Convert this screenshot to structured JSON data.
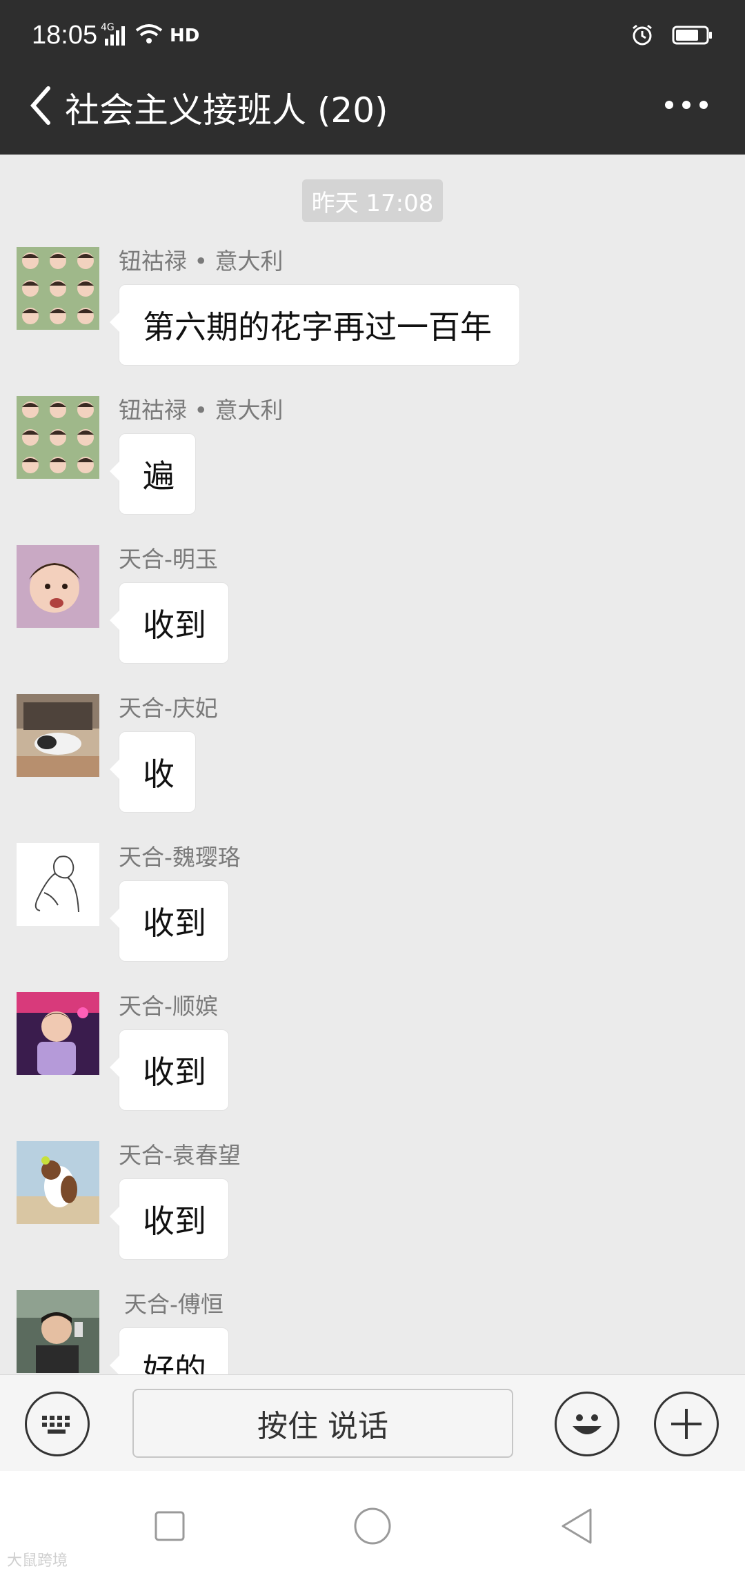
{
  "status_bar": {
    "time": "18:05",
    "network_label": "4G",
    "hd_label": "HD",
    "icons": [
      "signal-icon",
      "wifi-icon",
      "alarm-icon",
      "battery-icon"
    ]
  },
  "header": {
    "title": "社会主义接班人 (20)",
    "back_icon": "chevron-left-icon",
    "more_icon": "more-dots-icon"
  },
  "chat": {
    "timestamp": "昨天 17:08",
    "messages": [
      {
        "sender": "钮祜禄 • 意大利",
        "text": "第六期的花字再过一百年",
        "avatar": "grid-photos-avatar"
      },
      {
        "sender": "钮祜禄 • 意大利",
        "text": "遍",
        "avatar": "grid-photos-avatar"
      },
      {
        "sender": "天合-明玉",
        "text": "收到",
        "avatar": "child-photo-avatar"
      },
      {
        "sender": "天合-庆妃",
        "text": "收",
        "avatar": "cat-photo-avatar"
      },
      {
        "sender": "天合-魏璎珞",
        "text": "收到",
        "avatar": "sketch-avatar"
      },
      {
        "sender": "天合-顺嫔",
        "text": "收到",
        "avatar": "child-purple-avatar"
      },
      {
        "sender": "天合-袁春望",
        "text": "收到",
        "avatar": "dog-photo-avatar"
      },
      {
        "sender": "天合-傅恒",
        "text": "好的",
        "avatar": "man-selfie-avatar"
      }
    ]
  },
  "input_bar": {
    "talk_label": "按住 说话",
    "keyboard_icon": "keyboard-icon",
    "emoji_icon": "emoji-icon",
    "plus_icon": "plus-icon"
  },
  "nav_bar": {
    "icons": [
      "recent-apps-icon",
      "home-icon",
      "back-triangle-icon"
    ]
  },
  "watermark": "大鼠跨境",
  "colors": {
    "header_bg": "#2e2e2e",
    "chat_bg": "#ebebeb",
    "bubble_bg": "#ffffff",
    "timestamp_chip": "#d4d4d4"
  }
}
